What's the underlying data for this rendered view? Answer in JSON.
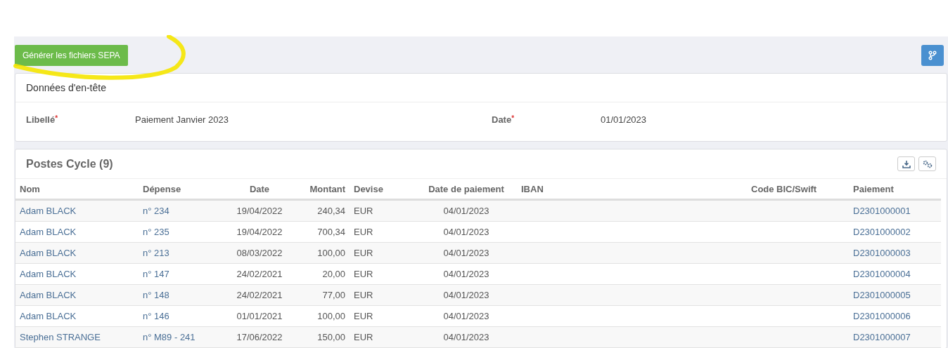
{
  "toolbar": {
    "generate_button": "Générer les fichiers SEPA"
  },
  "header_card": {
    "title": "Données d'en-tête",
    "fields": [
      {
        "label": "Libellé",
        "required_mark": "*",
        "value": "Paiement Janvier 2023"
      },
      {
        "label": "Date",
        "required_mark": "*",
        "value": "01/01/2023"
      }
    ]
  },
  "table": {
    "title": "Postes Cycle (9)",
    "columns": [
      "Nom",
      "Dépense",
      "Date",
      "Montant",
      "Devise",
      "Date de paiement",
      "IBAN",
      "Code BIC/Swift",
      "Paiement"
    ],
    "rows": [
      [
        "Adam BLACK",
        "n° 234",
        "19/04/2022",
        "240,34",
        "EUR",
        "04/01/2023",
        "",
        "",
        "D2301000001"
      ],
      [
        "Adam BLACK",
        "n° 235",
        "19/04/2022",
        "700,34",
        "EUR",
        "04/01/2023",
        "",
        "",
        "D2301000002"
      ],
      [
        "Adam BLACK",
        "n° 213",
        "08/03/2022",
        "100,00",
        "EUR",
        "04/01/2023",
        "",
        "",
        "D2301000003"
      ],
      [
        "Adam BLACK",
        "n° 147",
        "24/02/2021",
        "20,00",
        "EUR",
        "04/01/2023",
        "",
        "",
        "D2301000004"
      ],
      [
        "Adam BLACK",
        "n° 148",
        "24/02/2021",
        "77,00",
        "EUR",
        "04/01/2023",
        "",
        "",
        "D2301000005"
      ],
      [
        "Adam BLACK",
        "n° 146",
        "01/01/2021",
        "100,00",
        "EUR",
        "04/01/2023",
        "",
        "",
        "D2301000006"
      ],
      [
        "Stephen STRANGE",
        "n° M89 - 241",
        "17/06/2022",
        "150,00",
        "EUR",
        "04/01/2023",
        "",
        "",
        "D2301000007"
      ]
    ]
  }
}
